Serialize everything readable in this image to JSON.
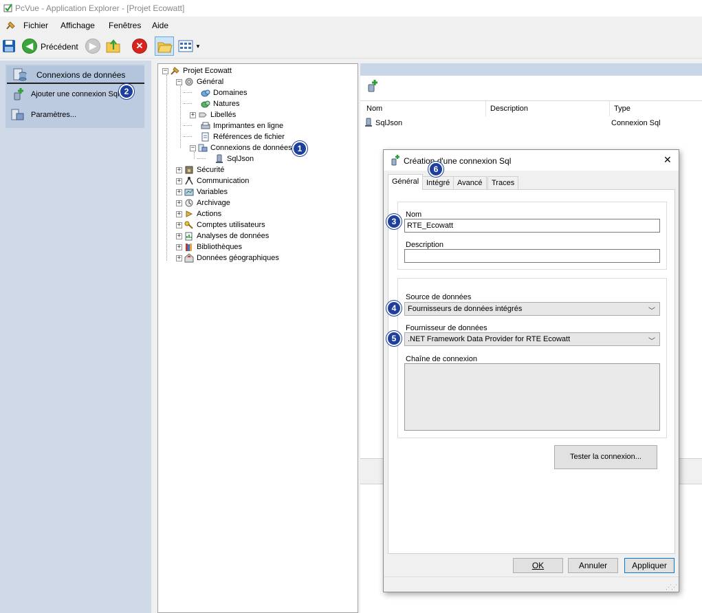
{
  "window": {
    "title": "PcVue - Application Explorer - [Projet Ecowatt]"
  },
  "menu": [
    "Fichier",
    "Affichage",
    "Fenêtres",
    "Aide"
  ],
  "toolbar": {
    "back_label": "Précédent"
  },
  "leftnav": {
    "header": "Connexions de données",
    "items": [
      "Ajouter une connexion Sql",
      "Paramètres..."
    ]
  },
  "tree": {
    "root": "Projet Ecowatt",
    "general": "Général",
    "general_children": [
      "Domaines",
      "Natures",
      "Libellés",
      "Imprimantes en ligne",
      "Références de fichier",
      "Connexions de données"
    ],
    "connection_child": "SqlJson",
    "top_nodes": [
      "Sécurité",
      "Communication",
      "Variables",
      "Archivage",
      "Actions",
      "Comptes utilisateurs",
      "Analyses de données",
      "Bibliothèques",
      "Données géographiques"
    ]
  },
  "list": {
    "columns": [
      "Nom",
      "Description",
      "Type"
    ],
    "rows": [
      {
        "name": "SqlJson",
        "description": "",
        "type": "Connexion Sql"
      }
    ]
  },
  "badges": [
    "1",
    "2",
    "3",
    "4",
    "5",
    "6"
  ],
  "dialog": {
    "title": "Création d'une connexion Sql",
    "tabs": [
      "Général",
      "Intégré",
      "Avancé",
      "Traces"
    ],
    "name_label": "Nom",
    "name_value": "RTE_Ecowatt",
    "description_label": "Description",
    "description_value": "",
    "source_label": "Source de données",
    "source_value": "Fournisseurs de données intégrés",
    "provider_label": "Fournisseur de données",
    "provider_value": ".NET Framework Data Provider for RTE Ecowatt",
    "connstring_label": "Chaîne de connexion",
    "connstring_value": "",
    "test_button": "Tester la connexion...",
    "ok_button": "OK",
    "cancel_button": "Annuler",
    "apply_button": "Appliquer",
    "close_glyph": "✕"
  }
}
